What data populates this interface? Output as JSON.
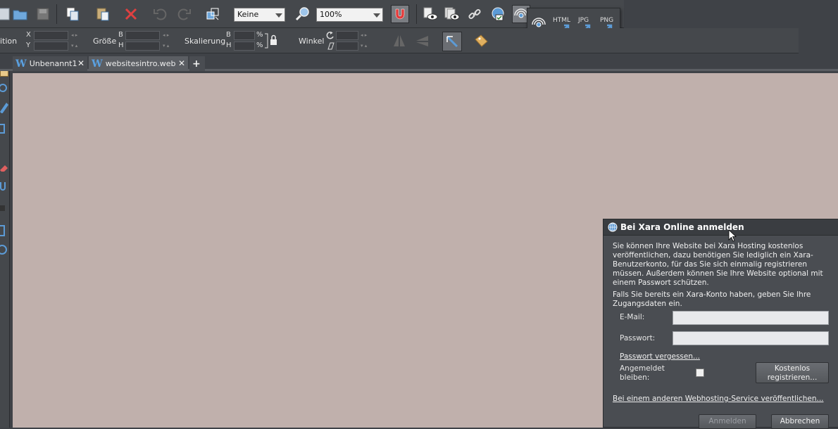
{
  "toolbar": {
    "snap_select": "Keine",
    "zoom_select": "100%",
    "export_popup": [
      "HTML",
      "JPG",
      "PNG"
    ]
  },
  "infobar": {
    "position_label": "ition",
    "x_label": "X",
    "y_label": "Y",
    "size_label": "Größe",
    "b_label": "B",
    "h_label": "H",
    "scale_label": "Skalierung",
    "percent": "%",
    "angle_label": "Winkel"
  },
  "tabs": [
    {
      "label": "Unbenannt1",
      "close": "✕"
    },
    {
      "label": "websitesintro.web",
      "close": "✕"
    }
  ],
  "tab_add": "+",
  "dialog": {
    "title": "Bei Xara Online anmelden",
    "intro": "Sie können Ihre Website bei Xara Hosting kostenlos veröffentlichen, dazu benötigen Sie lediglich ein Xara-Benutzerkonto, für das Sie sich einmalig registrieren müssen. Außerdem können Sie Ihre Website optional mit einem Passwort schützen.",
    "hint": "Falls Sie bereits ein Xara-Konto haben, geben Sie Ihre Zugangsdaten ein.",
    "email_label": "E-Mail:",
    "email_value": "",
    "password_label": "Passwort:",
    "password_value": "",
    "forgot_link": "Passwort vergessen...",
    "remember_label": "Angemeldet bleiben:",
    "register_button": "Kostenlos registrieren...",
    "other_host_link": "Bei einem anderen Webhosting-Service veröffentlichen...",
    "login_button": "Anmelden",
    "cancel_button": "Abbrechen"
  },
  "colors": {
    "canvas": "#c0b0ac",
    "chrome": "#45484c",
    "accent": "#5aa0e0",
    "close_red": "#e04040"
  }
}
